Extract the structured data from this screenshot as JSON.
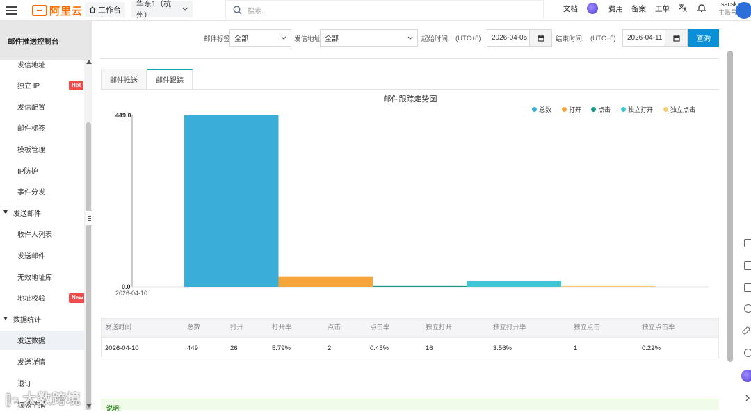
{
  "topbar": {
    "logo_text": "阿里云",
    "workbench": "工作台",
    "region": "华东1（杭州）",
    "search_placeholder": "搜索...",
    "nav": [
      "文档",
      "费用",
      "备案",
      "工单"
    ],
    "user_name": "sacsk",
    "user_sub": "主账号"
  },
  "sidebar": {
    "title": "邮件推送控制台",
    "items": [
      {
        "label": "发信地址"
      },
      {
        "label": "独立 IP",
        "badge": "Hot"
      },
      {
        "label": "发信配置"
      },
      {
        "label": "邮件标签"
      },
      {
        "label": "模板管理"
      },
      {
        "label": "IP防护"
      },
      {
        "label": "事件分发"
      },
      {
        "label": "发送邮件",
        "group": true
      },
      {
        "label": "收件人列表"
      },
      {
        "label": "发送邮件"
      },
      {
        "label": "无效地址库"
      },
      {
        "label": "地址校验",
        "badge": "New"
      },
      {
        "label": "数据统计",
        "group": true
      },
      {
        "label": "发送数据",
        "active": true
      },
      {
        "label": "发送详情"
      },
      {
        "label": "退订"
      },
      {
        "label": "垃圾举报"
      }
    ]
  },
  "filters": {
    "tag_label": "邮件标签",
    "tag_value": "全部",
    "addr_label": "发信地址",
    "addr_value": "全部",
    "start_label": "起始时间:",
    "start_tz": "(UTC+8)",
    "start_date": "2026-04-05",
    "end_label": "结束时间:",
    "end_tz": "(UTC+8)",
    "end_date": "2026-04-11",
    "query_button": "查询"
  },
  "tabs": [
    "邮件推送",
    "邮件跟踪"
  ],
  "active_tab": 1,
  "chart_data": {
    "type": "bar",
    "title": "邮件跟踪走势图",
    "categories": [
      "2026-04-10"
    ],
    "series": [
      {
        "name": "总数",
        "values": [
          449
        ],
        "color": "#3aaed8"
      },
      {
        "name": "打开",
        "values": [
          26
        ],
        "color": "#f5a53a"
      },
      {
        "name": "点击",
        "values": [
          2
        ],
        "color": "#1a9a8a"
      },
      {
        "name": "独立打开",
        "values": [
          16
        ],
        "color": "#3fc6d4"
      },
      {
        "name": "独立点击",
        "values": [
          1
        ],
        "color": "#f5cc72"
      }
    ],
    "ylim": [
      0,
      449
    ],
    "y_tick_labels": [
      "0.0",
      "449.0"
    ],
    "legend_position": "top-right"
  },
  "table": {
    "headers": [
      "发送时间",
      "总数",
      "打开",
      "打开率",
      "点击",
      "点击率",
      "独立打开",
      "独立打开率",
      "独立点击",
      "独立点击率"
    ],
    "rows": [
      [
        "2026-04-10",
        "449",
        "26",
        "5.79%",
        "2",
        "0.45%",
        "16",
        "3.56%",
        "1",
        "0.22%"
      ]
    ]
  },
  "note": "说明:",
  "watermark": "大数跨境"
}
